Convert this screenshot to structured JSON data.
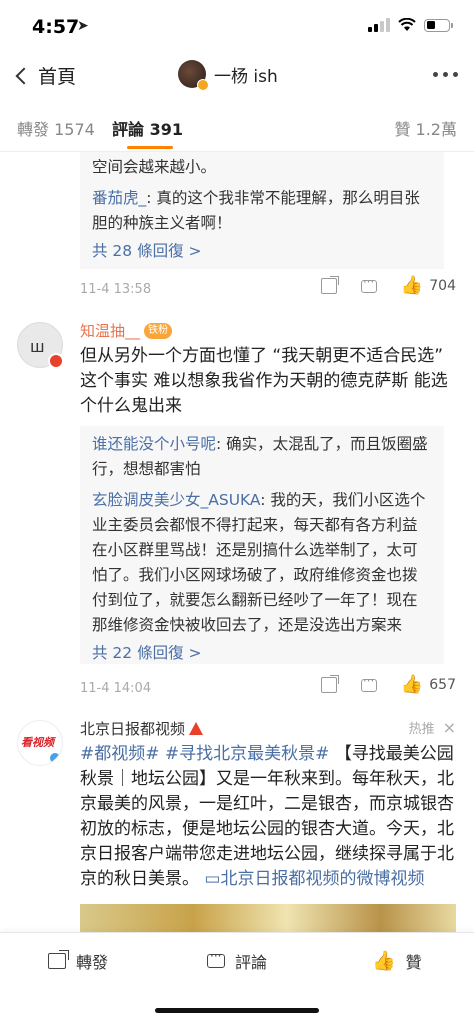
{
  "status": {
    "time": "4:57",
    "location_arrow": "➤"
  },
  "nav": {
    "back_label": "首頁",
    "title": "一杨 ish"
  },
  "tabs": {
    "repost": "轉發 1574",
    "comment": "評論 391",
    "like": "贊 1.2萬"
  },
  "thread1": {
    "reply_text_top": "空间会越来越小。",
    "reply2_author": "番茄虎_",
    "reply2_text": ": 真的这个我非常不能理解，那么明目张胆的种族主义者啊！",
    "more_replies": "共 28 條回復 >",
    "time": "11-4 13:58",
    "likes": "704"
  },
  "comment2": {
    "name": "知温抽__",
    "badge": "铁粉",
    "text": "但从另外一个方面也懂了 “我天朝更不适合民选” 这个事实 难以想象我省作为天朝的德克萨斯 能选个什么鬼出来",
    "reply1_author": "谁还能没个小号呢",
    "reply1_text": ": 确实，太混乱了，而且饭圈盛行，想想都害怕",
    "reply2_author": "玄脸调皮美少女_ASUKA",
    "reply2_text": ": 我的天，我们小区选个业主委员会都恨不得打起来，每天都有各方利益在小区群里骂战！还是别搞什么选举制了，太可怕了。我们小区网球场破了，政府维修资金也拨付到位了，就要怎么翻新已经吵了一年了！现在那维修资金快被收回去了，还是没选出方案来",
    "more_replies": "共 22 條回復 >",
    "time": "11-4 14:04",
    "likes": "657"
  },
  "promo": {
    "name": "北京日报都视频",
    "tag": "热推",
    "close": "×",
    "logo_text": "看视频",
    "hashtag1": "#都视频#",
    "hashtag2": "#寻找北京最美秋景#",
    "body": "【寻找最美公园秋景｜地坛公园】又是一年秋来到。每年秋天，北京最美的风景，一是红叶，二是银杏，而京城银杏初放的标志，便是地坛公园的银杏大道。今天，北京日报客户端带您走进地坛公园，继续探寻属于北京的秋日美景。",
    "video_link": "北京日报都视频的微博视频"
  },
  "bottom": {
    "repost": "轉發",
    "comment": "評論",
    "like": "贊"
  },
  "icons": {
    "like": "like-icon",
    "share": "share-icon",
    "comment": "comment-icon"
  }
}
